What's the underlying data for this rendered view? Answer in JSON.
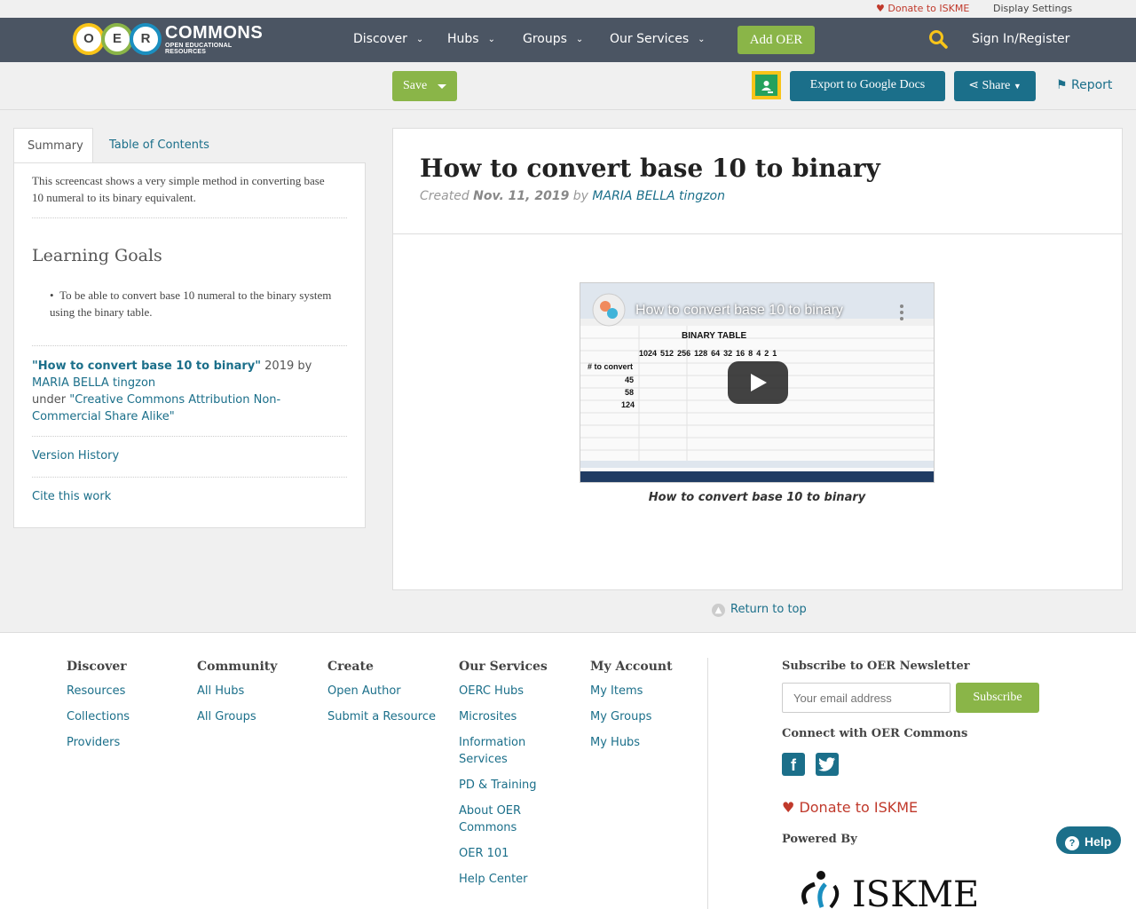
{
  "utility": {
    "donate": "Donate to ISKME",
    "display_settings": "Display Settings"
  },
  "logo": {
    "letters": [
      "O",
      "E",
      "R"
    ],
    "word": "COMMONS",
    "tagline": "OPEN EDUCATIONAL RESOURCES"
  },
  "nav": {
    "items": [
      {
        "label": "Discover"
      },
      {
        "label": "Hubs"
      },
      {
        "label": "Groups"
      },
      {
        "label": "Our Services"
      }
    ],
    "add_oer": "Add OER",
    "sign_in": "Sign In/Register"
  },
  "toolbar": {
    "save": "Save",
    "export": "Export to Google Docs",
    "share": "Share",
    "report": "Report"
  },
  "sidebar": {
    "tabs": [
      "Summary",
      "Table of Contents"
    ],
    "summary": "This screencast shows a very simple method in converting base 10 numeral to its binary equivalent.",
    "learning_goals_title": "Learning Goals",
    "learning_goals": [
      "To be able to convert base 10 numeral to the binary system using the binary table."
    ],
    "attribution": {
      "title": "\"How to convert base 10 to binary\"",
      "year_by": " 2019 by ",
      "author": "MARIA BELLA tingzon",
      "under": "under ",
      "license": "\"Creative Commons Attribution Non-Commercial Share Alike\""
    },
    "version_history": "Version History",
    "cite": "Cite this work"
  },
  "resource": {
    "title": "How to convert base 10 to binary",
    "created_label": "Created ",
    "date": "Nov. 11, 2019",
    "by": " by ",
    "author": "MARIA BELLA tingzon",
    "video_title": "How to convert base 10 to binary",
    "video_table": {
      "header": "BINARY TABLE",
      "place_values": [
        "1024",
        "512",
        "256",
        "128",
        "64",
        "32",
        "16",
        "8",
        "4",
        "2",
        "1"
      ],
      "row_label": "# to convert",
      "rows": [
        "45",
        "58",
        "124"
      ]
    },
    "caption": "How to convert base 10 to binary"
  },
  "return_top": "Return to top",
  "footer": {
    "columns": [
      {
        "title": "Discover",
        "links": [
          "Resources",
          "Collections",
          "Providers"
        ]
      },
      {
        "title": "Community",
        "links": [
          "All Hubs",
          "All Groups"
        ]
      },
      {
        "title": "Create",
        "links": [
          "Open Author",
          "Submit a Resource"
        ]
      },
      {
        "title": "Our Services",
        "links": [
          "OERC Hubs",
          "Microsites",
          "Information Services",
          "PD & Training",
          "About OER Commons",
          "OER 101",
          "Help Center"
        ]
      },
      {
        "title": "My Account",
        "links": [
          "My Items",
          "My Groups",
          "My Hubs"
        ]
      }
    ],
    "newsletter_title": "Subscribe to OER Newsletter",
    "email_placeholder": "Your email address",
    "subscribe": "Subscribe",
    "connect_title": "Connect with OER Commons",
    "donate": "Donate to ISKME",
    "powered_by": "Powered By",
    "iskme": "ISKME"
  },
  "help": "Help",
  "colors": {
    "nav": "#4b5563",
    "accent_green": "#8ab548",
    "accent_teal": "#1b6f8a",
    "donate_red": "#c0392b"
  }
}
